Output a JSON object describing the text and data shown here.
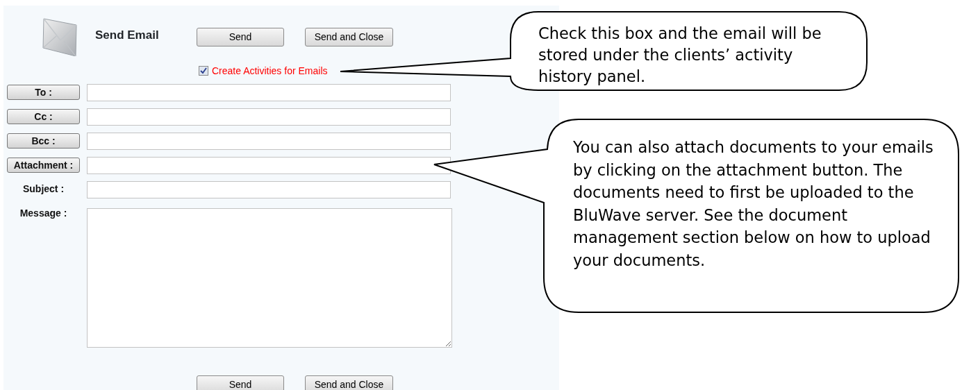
{
  "header": {
    "title": "Send Email",
    "buttons": [
      "Send",
      "Send and Close"
    ]
  },
  "create_activities": {
    "label": "Create Activities for Emails",
    "checked": true
  },
  "fields": [
    {
      "label": "To :",
      "kind": "button"
    },
    {
      "label": "Cc :",
      "kind": "button"
    },
    {
      "label": "Bcc :",
      "kind": "button"
    },
    {
      "label": "Attachment :",
      "kind": "button"
    },
    {
      "label": "Subject :",
      "kind": "text"
    },
    {
      "label": "Message :",
      "kind": "textarea"
    }
  ],
  "footer_buttons": [
    "Send",
    "Send and Close"
  ],
  "callouts": [
    {
      "text": "Check this box and the email will be stored under the clients’ activity history panel."
    },
    {
      "text": "You can also attach documents to your emails by clicking on the attachment button. The documents need to first be uploaded to the BluWave server. See the document management section below on how to upload your documents."
    }
  ]
}
